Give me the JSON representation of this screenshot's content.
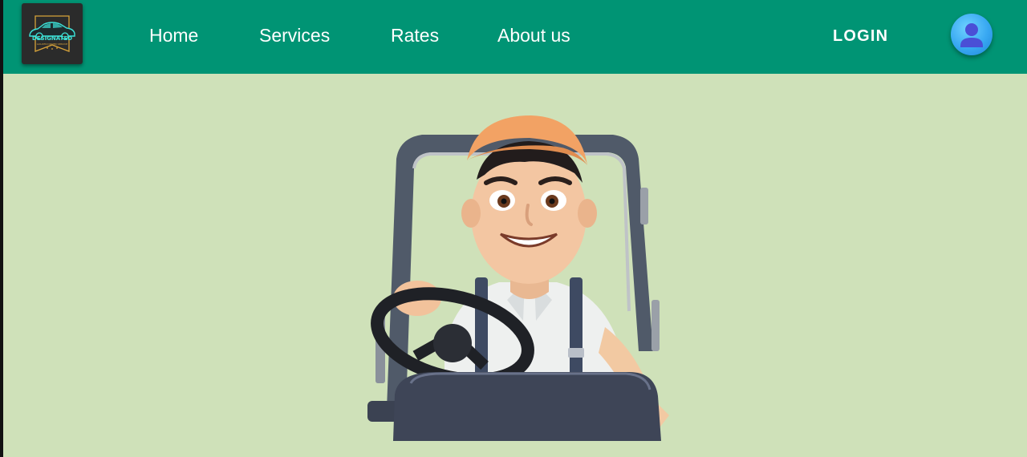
{
  "logo": {
    "name": "DESIGNATED",
    "subtitle": "GOLDEN DRIVER SERVICE"
  },
  "nav": {
    "items": [
      {
        "label": "Home"
      },
      {
        "label": "Services"
      },
      {
        "label": "Rates"
      },
      {
        "label": "About us"
      }
    ],
    "login_label": "LOGIN"
  },
  "colors": {
    "header": "#009474",
    "background": "#cfe1b9",
    "accent": "#38a8f2"
  },
  "icons": {
    "logo": "car-logo-icon",
    "avatar": "user-icon"
  },
  "hero": {
    "image": "cartoon-driver-illustration"
  }
}
